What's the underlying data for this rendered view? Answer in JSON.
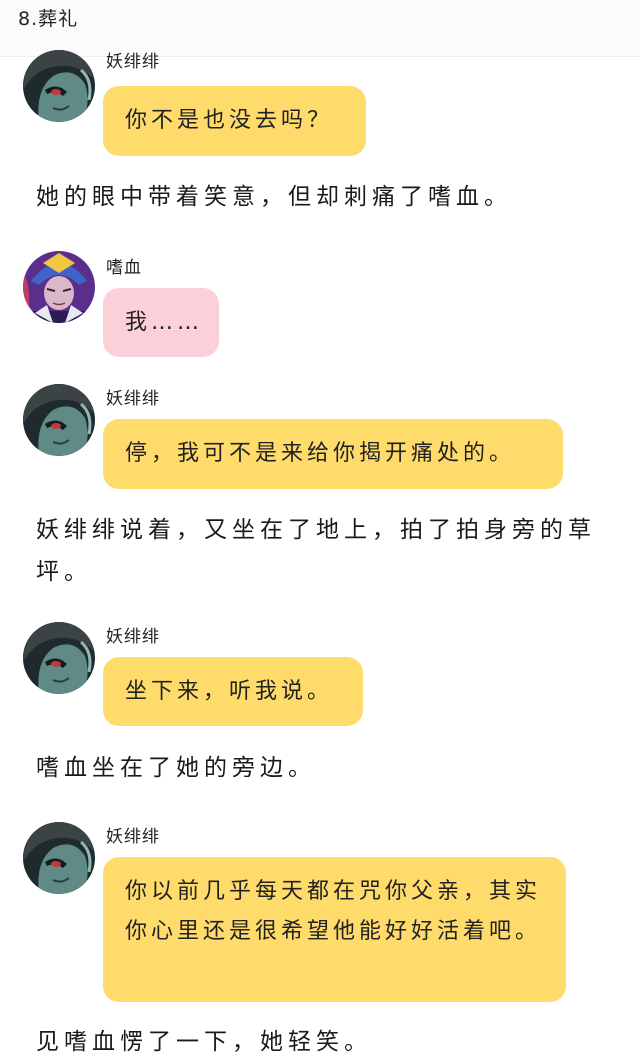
{
  "header": {
    "title": "8.葬礼"
  },
  "messages": [
    {
      "speaker": "妖绯绯",
      "text": "你不是也没去吗？",
      "avatar": "alien-girl-avatar",
      "bubble_color": "#fedb6b"
    },
    {
      "narration": "她的眼中带着笑意，但却刺痛了嗜血。"
    },
    {
      "speaker": "嗜血",
      "text": "我……",
      "avatar": "armored-boy-avatar",
      "bubble_color": "#fcd0d9"
    },
    {
      "speaker": "妖绯绯",
      "text": "停，我可不是来给你揭开痛处的。",
      "avatar": "alien-girl-avatar",
      "bubble_color": "#fedb6b"
    },
    {
      "narration": "妖绯绯说着，又坐在了地上，拍了拍身旁的草坪。"
    },
    {
      "speaker": "妖绯绯",
      "text": "坐下来，听我说。",
      "avatar": "alien-girl-avatar",
      "bubble_color": "#fedb6b"
    },
    {
      "narration": "嗜血坐在了她的旁边。"
    },
    {
      "speaker": "妖绯绯",
      "text": "你以前几乎每天都在咒你父亲，其实你心里还是很希望他能好好活着吧。",
      "avatar": "alien-girl-avatar",
      "bubble_color": "#fedb6b"
    },
    {
      "narration": "见嗜血愣了一下，她轻笑。"
    }
  ]
}
